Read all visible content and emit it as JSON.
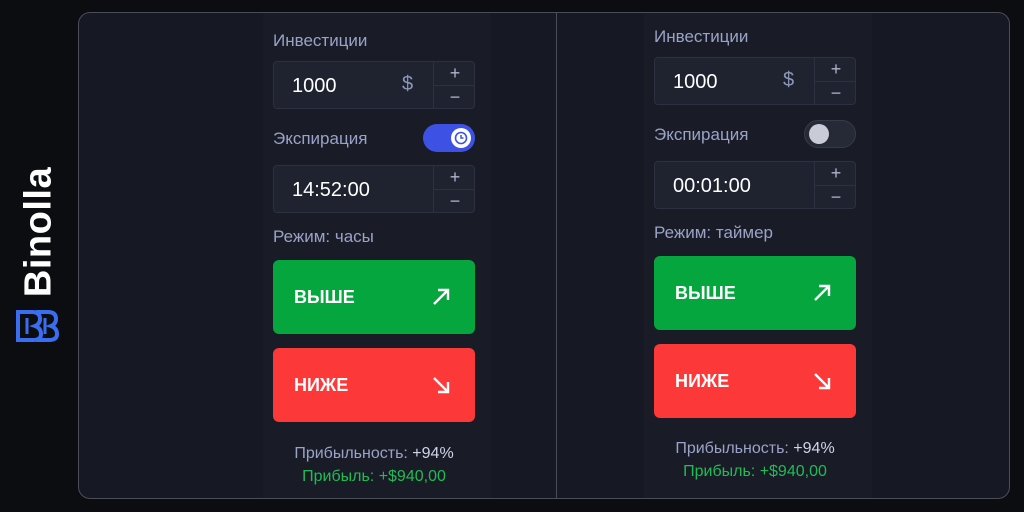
{
  "brand": {
    "name": "Binolla",
    "color": "#3a6df0"
  },
  "colors": {
    "up": "#06a63e",
    "down": "#fd3838",
    "toggle_on": "#3d52e4",
    "profit": "#1fbc55"
  },
  "panels": [
    {
      "investment_label": "Инвестиции",
      "investment_value": "1000",
      "currency": "$",
      "plus": "+",
      "minus": "−",
      "expiration_label": "Экспирация",
      "expiration_toggle": "on",
      "time_value": "14:52:00",
      "mode_label": "Режим: часы",
      "up_label": "ВЫШЕ",
      "down_label": "НИЖЕ",
      "profitability_label": "Прибыльность:",
      "profitability_value": "+94%",
      "profit_label": "Прибыль:",
      "profit_value": "+$940,00"
    },
    {
      "investment_label": "Инвестиции",
      "investment_value": "1000",
      "currency": "$",
      "plus": "+",
      "minus": "−",
      "expiration_label": "Экспирация",
      "expiration_toggle": "off",
      "time_value": "00:01:00",
      "mode_label": "Режим: таймер",
      "up_label": "ВЫШЕ",
      "down_label": "НИЖЕ",
      "profitability_label": "Прибыльность:",
      "profitability_value": "+94%",
      "profit_label": "Прибыль:",
      "profit_value": "+$940,00"
    }
  ]
}
